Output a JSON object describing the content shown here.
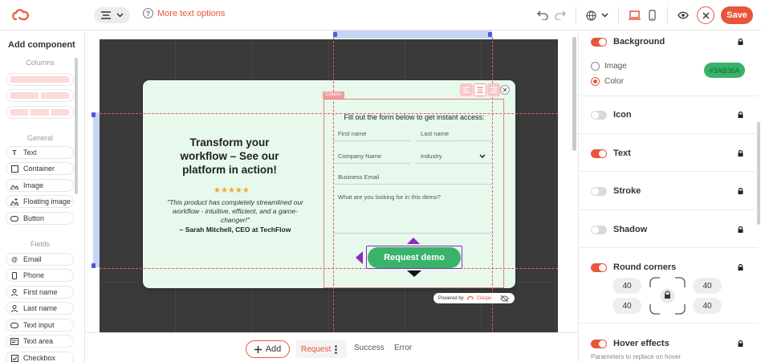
{
  "header": {
    "more_text_options": "More text options",
    "save_label": "Save"
  },
  "left_panel": {
    "title": "Add component",
    "columns_label": "Columns",
    "general_label": "General",
    "fields_label": "Fields",
    "general_items": [
      "Text",
      "Container",
      "Image",
      "Floating image",
      "Button"
    ],
    "field_items": [
      "Email",
      "Phone",
      "First name",
      "Last name",
      "Text input",
      "Text area",
      "Checkbox"
    ]
  },
  "popup": {
    "heading": "Transform your workflow – See our platform in action!",
    "stars": "★★★★★",
    "quote": "\"This product has completely streamlined our workflow - intuitive, efficient, and a game-changer!\"",
    "author": "– Sarah Mitchell, CEO at TechFlow",
    "column_tag": "Column",
    "form_title": "Fill out the form below to get instant access:",
    "fields": {
      "first_name": "First name",
      "last_name": "Last name",
      "company_name": "Company Name",
      "industry": "Industry",
      "business_email": "Business Email",
      "textarea": "What are you looking for in this demo?"
    },
    "button_label": "Request demo",
    "powered_by": "Powered by",
    "brand": "Claspo"
  },
  "bottom_bar": {
    "add_label": "Add",
    "tabs": [
      "Request",
      "Success",
      "Error"
    ]
  },
  "right_panel": {
    "background_label": "Background",
    "image_option": "Image",
    "color_option": "Color",
    "color_value": "#3AB36A",
    "icon_label": "Icon",
    "text_label": "Text",
    "stroke_label": "Stroke",
    "shadow_label": "Shadow",
    "round_corners_label": "Round corners",
    "corners": [
      "40",
      "40",
      "40",
      "40"
    ],
    "hover_label": "Hover effects",
    "hover_sub": "Parameters to replace on hover"
  },
  "colors": {
    "accent": "#e8553b",
    "button_green": "#3ab36a",
    "popup_bg": "#e7f8ec"
  }
}
